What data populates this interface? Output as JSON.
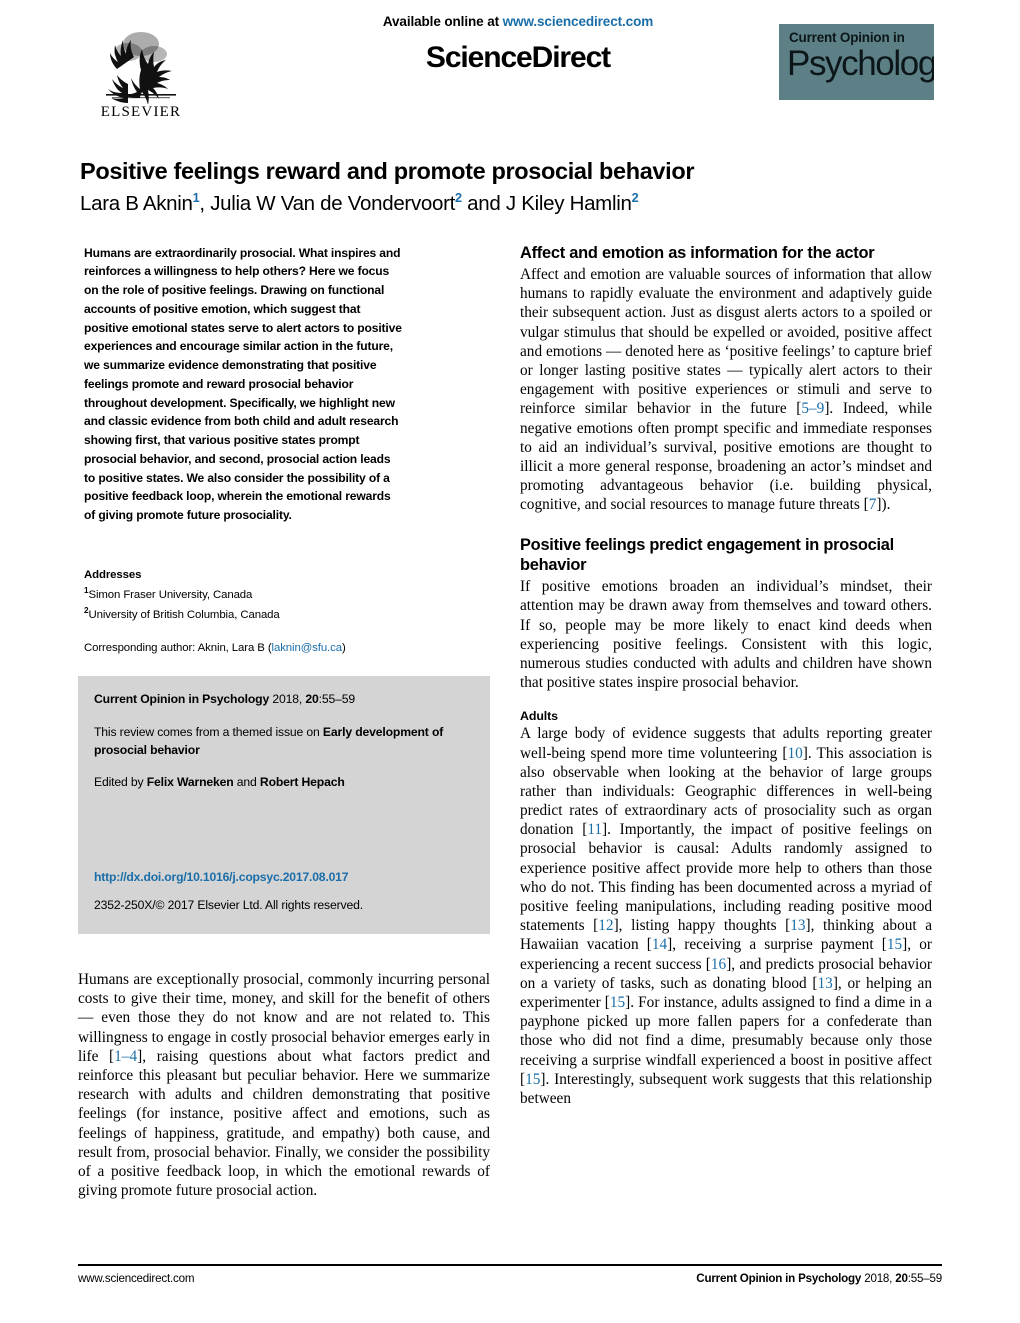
{
  "masthead": {
    "available_prefix": "Available online at ",
    "available_url": "www.sciencedirect.com",
    "sciencedirect_wordmark": "ScienceDirect",
    "elsevier_wordmark": "ELSEVIER",
    "journal_logo_line1": "Current Opinion in",
    "journal_logo_line2": "Psychology",
    "journal_logo_bg": "#5d8087"
  },
  "title": "Positive feelings reward and promote prosocial behavior",
  "authors": {
    "a1_name": "Lara B Aknin",
    "a1_sup": "1",
    "sep1": ", ",
    "a2_name": "Julia W Van de Vondervoort",
    "a2_sup": "2",
    "sep2": " and ",
    "a3_name": "J Kiley Hamlin",
    "a3_sup": "2"
  },
  "abstract": "Humans are extraordinarily prosocial. What inspires and reinforces a willingness to help others? Here we focus on the role of positive feelings. Drawing on functional accounts of positive emotion, which suggest that positive emotional states serve to alert actors to positive experiences and encourage similar action in the future, we summarize evidence demonstrating that positive feelings promote and reward prosocial behavior throughout development. Specifically, we highlight new and classic evidence from both child and adult research showing first, that various positive states prompt prosocial behavior, and second, prosocial action leads to positive states. We also consider the possibility of a positive feedback loop, wherein the emotional rewards of giving promote future prosociality.",
  "addresses": {
    "heading": "Addresses",
    "line1_sup": "1",
    "line1": "Simon Fraser University, Canada",
    "line2_sup": "2",
    "line2": "University of British Columbia, Canada",
    "corresponding_prefix": "Corresponding author: Aknin, Lara B (",
    "corresponding_email": "laknin@sfu.ca",
    "corresponding_suffix": ")"
  },
  "infobox": {
    "citation_journal": "Current Opinion in Psychology",
    "citation_rest_1": " 2018, ",
    "citation_volume": "20",
    "citation_rest_2": ":55–59",
    "themed_prefix": "This review comes from a themed issue on ",
    "themed_issue": "Early development of prosocial behavior",
    "edited_prefix": "Edited by ",
    "editor_1": "Felix Warneken",
    "edited_middle": " and ",
    "editor_2": "Robert Hepach",
    "doi": "http://dx.doi.org/10.1016/j.copsyc.2017.08.017",
    "copyright": "2352-250X/© 2017 Elsevier Ltd. All rights reserved."
  },
  "left_body": {
    "p1_part1": "Humans are exceptionally prosocial, commonly incurring personal costs to give their time, money, and skill for the benefit of others — even those they do not know and are not related to. This willingness to engage in costly prosocial behavior emerges early in life [",
    "p1_ref1": "1–4",
    "p1_part2": "], raising questions about what factors predict and reinforce this pleasant but peculiar behavior. Here we summarize research with adults and children demonstrating that positive feelings (for instance, positive affect and emotions, such as feelings of happiness, gratitude, and empathy) both cause, and result from, prosocial behavior. Finally, we consider the possibility of a positive feedback loop, in which the emotional rewards of giving promote future prosocial action."
  },
  "right_body": {
    "h1": "Affect and emotion as information for the actor",
    "s1_part1": "Affect and emotion are valuable sources of information that allow humans to rapidly evaluate the environment and adaptively guide their subsequent action. Just as disgust alerts actors to a spoiled or vulgar stimulus that should be expelled or avoided, positive affect and emotions — denoted here as ‘positive feelings’ to capture brief or longer lasting positive states — typically alert actors to their engagement with positive experiences or stimuli and serve to reinforce similar behavior in the future [",
    "s1_ref1": "5–9",
    "s1_part2": "]. Indeed, while negative emotions often prompt specific and immediate responses to aid an individual’s survival, positive emotions are thought to illicit a more general response, broadening an actor’s mindset and promoting advantageous behavior (i.e. building physical, cognitive, and social resources to manage future threats [",
    "s1_ref2": "7",
    "s1_part3": "]).",
    "h2": "Positive feelings predict engagement in prosocial behavior",
    "s2": "If positive emotions broaden an individual’s mindset, their attention may be drawn away from themselves and toward others. If so, people may be more likely to enact kind deeds when experiencing positive feelings. Consistent with this logic, numerous studies conducted with adults and children have shown that positive states inspire prosocial behavior.",
    "h3": "Adults",
    "s3_part1": "A large body of evidence suggests that adults reporting greater well-being spend more time volunteering [",
    "s3_ref1": "10",
    "s3_part2": "]. This association is also observable when looking at the behavior of large groups rather than individuals: Geographic differences in well-being predict rates of extraordinary acts of prosociality such as organ donation [",
    "s3_ref2": "11",
    "s3_part3": "]. Importantly, the impact of positive feelings on prosocial behavior is causal: Adults randomly assigned to experience positive affect provide more help to others than those who do not. This finding has been documented across a myriad of positive feeling manipulations, including reading positive mood statements [",
    "s3_ref3": "12",
    "s3_part4": "], listing happy thoughts [",
    "s3_ref4": "13",
    "s3_part5": "], thinking about a Hawaiian vacation [",
    "s3_ref5": "14",
    "s3_part6": "], receiving a surprise payment [",
    "s3_ref6": "15",
    "s3_part7": "], or experiencing a recent success [",
    "s3_ref7": "16",
    "s3_part8": "], and predicts prosocial behavior on a variety of tasks, such as donating blood [",
    "s3_ref8": "13",
    "s3_part9": "], or helping an experimenter [",
    "s3_ref9": "15",
    "s3_part10": "]. For instance, adults assigned to find a dime in a payphone picked up more fallen papers for a confederate than those who did not find a dime, presumably because only those receiving a surprise windfall experienced a boost in positive affect [",
    "s3_ref10": "15",
    "s3_part11": "]. Interestingly, subsequent work suggests that this relationship between"
  },
  "footer": {
    "left": "www.sciencedirect.com",
    "right_journal": "Current Opinion in Psychology",
    "right_rest_1": " 2018, ",
    "right_volume": "20",
    "right_rest_2": ":55–59"
  },
  "colors": {
    "link": "#1a6ea8",
    "infobox_bg": "#d4d4d4",
    "journal_teal": "#5d8087"
  }
}
